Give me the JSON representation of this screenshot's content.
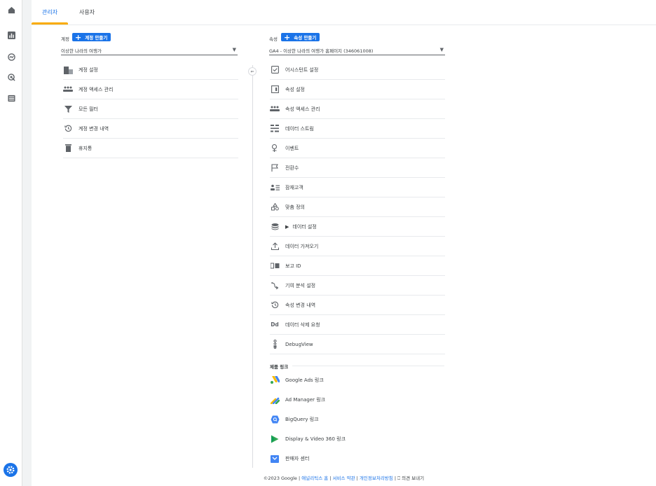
{
  "tabs": [
    {
      "label": "관리자",
      "active": true
    },
    {
      "label": "사용자",
      "active": false
    }
  ],
  "account": {
    "label": "계정",
    "create_label": "계정 만들기",
    "selected": "이상한 나라의 여행가",
    "items": [
      {
        "label": "계정 설정",
        "icon": "building-icon"
      },
      {
        "label": "계정 액세스 관리",
        "icon": "people-icon"
      },
      {
        "label": "모든 필터",
        "icon": "filter-icon"
      },
      {
        "label": "계정 변경 내역",
        "icon": "history-icon"
      },
      {
        "label": "휴지통",
        "icon": "trash-icon"
      }
    ]
  },
  "property": {
    "label": "속성",
    "create_label": "속성 만들기",
    "selected": "GA4 - 이상한 나라의 여행가 홈페이지 (346061008)",
    "items": [
      {
        "label": "어시스턴트 설정",
        "icon": "checkbox-icon"
      },
      {
        "label": "속성 설정",
        "icon": "property-settings-icon"
      },
      {
        "label": "속성 액세스 관리",
        "icon": "people-icon"
      },
      {
        "label": "데이터 스트림",
        "icon": "data-streams-icon"
      },
      {
        "label": "이벤트",
        "icon": "events-icon"
      },
      {
        "label": "전환수",
        "icon": "flag-icon"
      },
      {
        "label": "잠재고객",
        "icon": "audiences-icon"
      },
      {
        "label": "맞춤 정의",
        "icon": "shapes-icon"
      },
      {
        "label": "데이터 설정",
        "icon": "database-icon",
        "expandable": true
      },
      {
        "label": "데이터 가져오기",
        "icon": "upload-icon"
      },
      {
        "label": "보고 ID",
        "icon": "reporting-id-icon"
      },
      {
        "label": "기여 분석 설정",
        "icon": "attribution-icon"
      },
      {
        "label": "속성 변경 내역",
        "icon": "history-icon"
      },
      {
        "label": "데이터 삭제 요청",
        "icon": "dd-icon",
        "icon_text": "Dd"
      },
      {
        "label": "DebugView",
        "icon": "debug-icon"
      }
    ],
    "product_links_label": "제품 링크",
    "product_links": [
      {
        "label": "Google Ads 링크",
        "icon": "google-ads-icon"
      },
      {
        "label": "Ad Manager 링크",
        "icon": "ad-manager-icon"
      },
      {
        "label": "BigQuery 링크",
        "icon": "bigquery-icon"
      },
      {
        "label": "Display & Video 360 링크",
        "icon": "dv360-icon"
      },
      {
        "label": "판매자 센터",
        "icon": "merchant-center-icon"
      }
    ]
  },
  "footer": {
    "copyright": "©2023 Google |",
    "links": [
      "애널리틱스 홈",
      "서비스 약관",
      "개인정보처리방침"
    ],
    "feedback": "의견 보내기"
  },
  "colors": {
    "accent": "#1a73e8",
    "tab_underline": "#f9ab00"
  }
}
